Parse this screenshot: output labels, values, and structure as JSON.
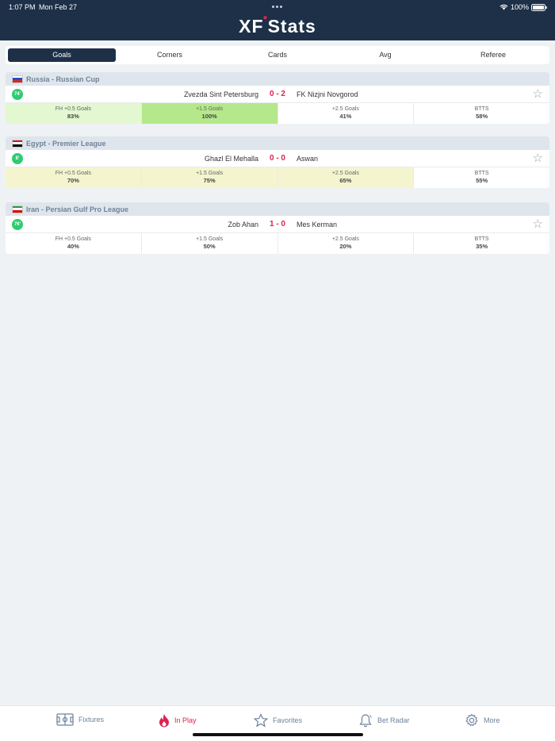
{
  "status": {
    "time": "1:07 PM",
    "date": "Mon Feb 27",
    "battery": "100%"
  },
  "app": {
    "title_left": "XF",
    "title_right": "Stats"
  },
  "tabs": [
    {
      "label": "Goals",
      "active": true
    },
    {
      "label": "Corners",
      "active": false
    },
    {
      "label": "Cards",
      "active": false
    },
    {
      "label": "Avg",
      "active": false
    },
    {
      "label": "Referee",
      "active": false
    }
  ],
  "leagues": [
    {
      "name": "Russia - Russian Cup",
      "flag": [
        "#ffffff",
        "#1f4ecf",
        "#d52b1e"
      ],
      "match": {
        "minute": "74'",
        "home": "Zvezda Sint Petersburg",
        "score": "0 - 2",
        "away": "FK Nizjni Novgorod"
      },
      "stats": [
        {
          "label": "FH +0.5 Goals",
          "value": "83%",
          "bg": "#e3f7d1"
        },
        {
          "label": "+1.5 Goals",
          "value": "100%",
          "bg": "#b4e88a"
        },
        {
          "label": "+2.5 Goals",
          "value": "41%",
          "bg": "#ffffff"
        },
        {
          "label": "BTTS",
          "value": "58%",
          "bg": "#ffffff"
        }
      ]
    },
    {
      "name": "Egypt - Premier League",
      "flag": [
        "#ce1126",
        "#ffffff",
        "#000000"
      ],
      "match": {
        "minute": "8'",
        "home": "Ghazl El Mehalla",
        "score": "0 - 0",
        "away": "Aswan"
      },
      "stats": [
        {
          "label": "FH +0.5 Goals",
          "value": "70%",
          "bg": "#f4f5cf"
        },
        {
          "label": "+1.5 Goals",
          "value": "75%",
          "bg": "#f4f5cf"
        },
        {
          "label": "+2.5 Goals",
          "value": "65%",
          "bg": "#f4f5cf"
        },
        {
          "label": "BTTS",
          "value": "55%",
          "bg": "#ffffff"
        }
      ]
    },
    {
      "name": "Iran - Persian Gulf Pro League",
      "flag": [
        "#239f40",
        "#ffffff",
        "#da0000"
      ],
      "match": {
        "minute": "76'",
        "home": "Zob Ahan",
        "score": "1 - 0",
        "away": "Mes Kerman"
      },
      "stats": [
        {
          "label": "FH +0.5 Goals",
          "value": "40%",
          "bg": "#ffffff"
        },
        {
          "label": "+1.5 Goals",
          "value": "50%",
          "bg": "#ffffff"
        },
        {
          "label": "+2.5 Goals",
          "value": "20%",
          "bg": "#ffffff"
        },
        {
          "label": "BTTS",
          "value": "35%",
          "bg": "#ffffff"
        }
      ]
    }
  ],
  "tabbar": [
    {
      "label": "Fixtures",
      "icon": "pitch-icon"
    },
    {
      "label": "In Play",
      "icon": "fire-icon"
    },
    {
      "label": "Favorites",
      "icon": "star-icon"
    },
    {
      "label": "Bet Radar",
      "icon": "bell-icon"
    },
    {
      "label": "More",
      "icon": "gear-icon"
    }
  ],
  "colors": {
    "header": "#1d3048",
    "accent": "#e0214d",
    "live": "#2ecc71"
  }
}
